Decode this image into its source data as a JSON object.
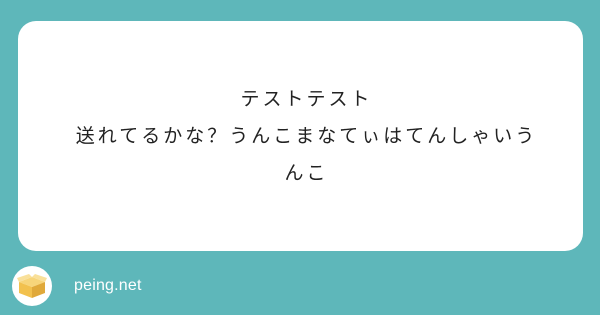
{
  "card": {
    "title": "テストテスト",
    "body_line1": "送れてるかな？うんこまなてぃはてんしゃいう",
    "body_line2": "んこ"
  },
  "footer": {
    "logo_icon": "box-icon",
    "site": "peing.net"
  },
  "colors": {
    "background": "#5eb7ba",
    "card": "#ffffff",
    "text": "#222222",
    "box": "#f2c14e"
  }
}
